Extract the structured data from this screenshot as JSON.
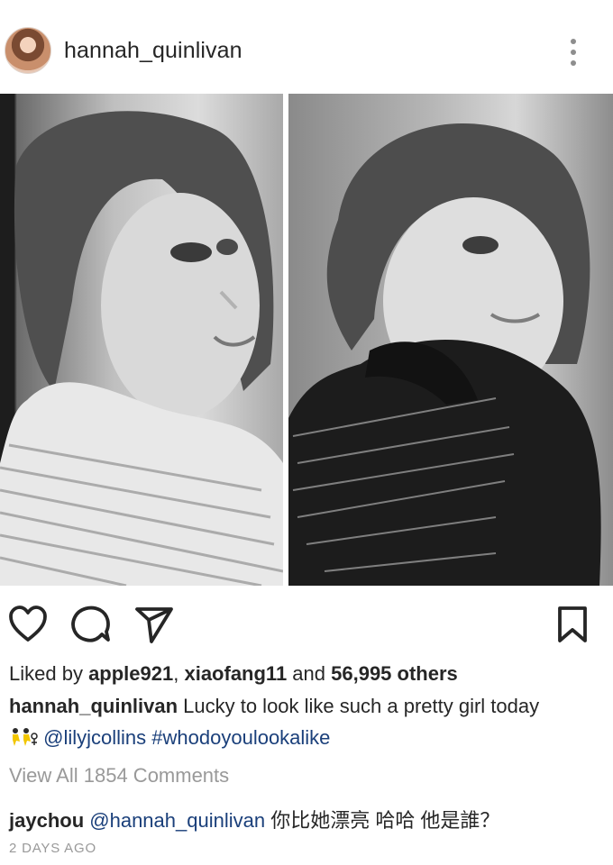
{
  "post": {
    "author": "hannah_quinlivan",
    "avatar_icon": "avatar-photo",
    "more_icon": "more-vertical-icon"
  },
  "images": [
    {
      "name": "left-photo",
      "description": "photo"
    },
    {
      "name": "right-photo",
      "description": "photo"
    }
  ],
  "actions": {
    "like_icon": "heart-icon",
    "comment_icon": "comment-icon",
    "share_icon": "send-icon",
    "save_icon": "bookmark-icon"
  },
  "likes": {
    "prefix": "Liked by ",
    "user1": "apple921",
    "separator": ", ",
    "user2": "xiaofang11",
    "middle": " and ",
    "others": "56,995 others"
  },
  "caption": {
    "username": "hannah_quinlivan",
    "text": " Lucky to look like such a pretty girl today",
    "mention": "@lilyjcollins",
    "hashtag": "#whodoyoulookalike",
    "emoji": "👯‍♀️"
  },
  "comments": {
    "view_all": "View All 1854 Comments",
    "items": [
      {
        "username": "jaychou",
        "mention": "@hannah_quinlivan",
        "text": " 你比她漂亮 哈哈 他是誰？"
      }
    ]
  },
  "timestamp": "2 DAYS AGO",
  "colors": {
    "text": "#262626",
    "muted": "#999999",
    "link": "#1a3f7a"
  }
}
